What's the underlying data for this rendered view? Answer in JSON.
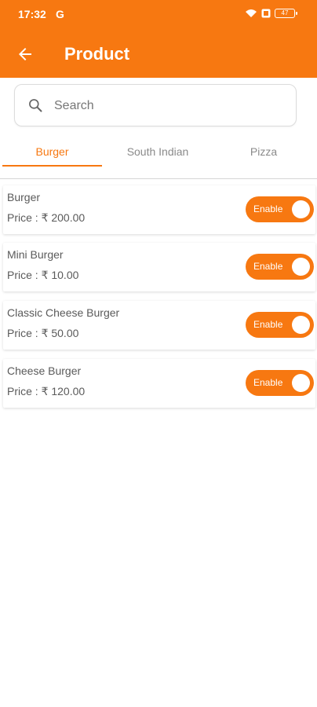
{
  "status_bar": {
    "time": "17:32",
    "extra": "G",
    "battery": "47"
  },
  "header": {
    "title": "Product",
    "back_icon": "arrow-back-icon"
  },
  "search": {
    "placeholder": "Search",
    "value": ""
  },
  "tabs": [
    {
      "label": "Burger",
      "active": true
    },
    {
      "label": "South Indian",
      "active": false
    },
    {
      "label": "Pizza",
      "active": false
    }
  ],
  "products": [
    {
      "name": "Burger",
      "price_label": "Price  : ₹ 200.00",
      "toggle_label": "Enable",
      "enabled": true
    },
    {
      "name": "Mini Burger",
      "price_label": "Price  : ₹ 10.00",
      "toggle_label": "Enable",
      "enabled": true
    },
    {
      "name": "Classic Cheese Burger",
      "price_label": "Price  : ₹ 50.00",
      "toggle_label": "Enable",
      "enabled": true
    },
    {
      "name": "Cheese Burger",
      "price_label": "Price  : ₹ 120.00",
      "toggle_label": "Enable",
      "enabled": true
    }
  ],
  "colors": {
    "accent": "#f77811",
    "text_muted": "#8a8a8a"
  }
}
